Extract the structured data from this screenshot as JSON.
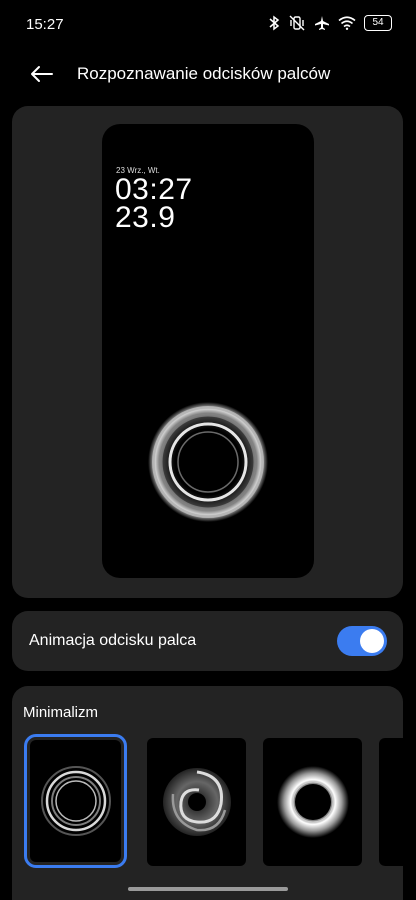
{
  "status_bar": {
    "time": "15:27",
    "battery": "54",
    "icons": [
      "bluetooth-icon",
      "vibrate-off-icon",
      "airplane-icon",
      "wifi-icon",
      "battery-icon"
    ]
  },
  "header": {
    "title": "Rozpoznawanie odcisków palców"
  },
  "preview": {
    "date": "23 Wrz., Wt.",
    "time": "03:27",
    "temperature": "23.9"
  },
  "animation_toggle": {
    "label": "Animacja odcisku palca",
    "enabled": true
  },
  "styles": {
    "title": "Minimalizm",
    "options": [
      {
        "icon": "thin-ring-icon",
        "selected": true
      },
      {
        "icon": "swirl-ring-icon",
        "selected": false
      },
      {
        "icon": "glow-ring-icon",
        "selected": false
      },
      {
        "icon": "partial-option-icon",
        "selected": false
      }
    ]
  },
  "colors": {
    "accent": "#3b7cf0",
    "card": "#232323",
    "background": "#000000"
  }
}
